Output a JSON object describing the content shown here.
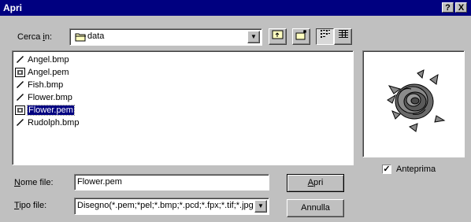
{
  "title": "Apri",
  "title_buttons": {
    "help": "?",
    "close": "X"
  },
  "look_in": {
    "label_pre": "Cerca ",
    "label_key": "i",
    "label_post": "n:",
    "value": "data"
  },
  "files": [
    {
      "name": "Angel.bmp",
      "icon": "paint-brush-icon",
      "selected": false
    },
    {
      "name": "Angel.pem",
      "icon": "pem-file-icon",
      "selected": false
    },
    {
      "name": "Fish.bmp",
      "icon": "paint-brush-icon",
      "selected": false
    },
    {
      "name": "Flower.bmp",
      "icon": "paint-brush-icon",
      "selected": false
    },
    {
      "name": "Flower.pem",
      "icon": "pem-file-icon",
      "selected": true
    },
    {
      "name": "Rudolph.bmp",
      "icon": "paint-brush-icon",
      "selected": false
    }
  ],
  "file_name": {
    "label_key": "N",
    "label_rest": "ome file:",
    "value": "Flower.pem"
  },
  "file_type": {
    "label_key": "T",
    "label_rest": "ipo file:",
    "value": "Disegno(*.pem;*pel;*.bmp;*.pcd;*.fpx;*.tif;*.jpg"
  },
  "buttons": {
    "open_key": "A",
    "open_rest": "pri",
    "cancel": "Annulla"
  },
  "preview": {
    "label": "Anteprima",
    "checked": true
  },
  "colors": {
    "titlebar": "#000080",
    "face": "#c0c0c0",
    "selection": "#000080"
  }
}
